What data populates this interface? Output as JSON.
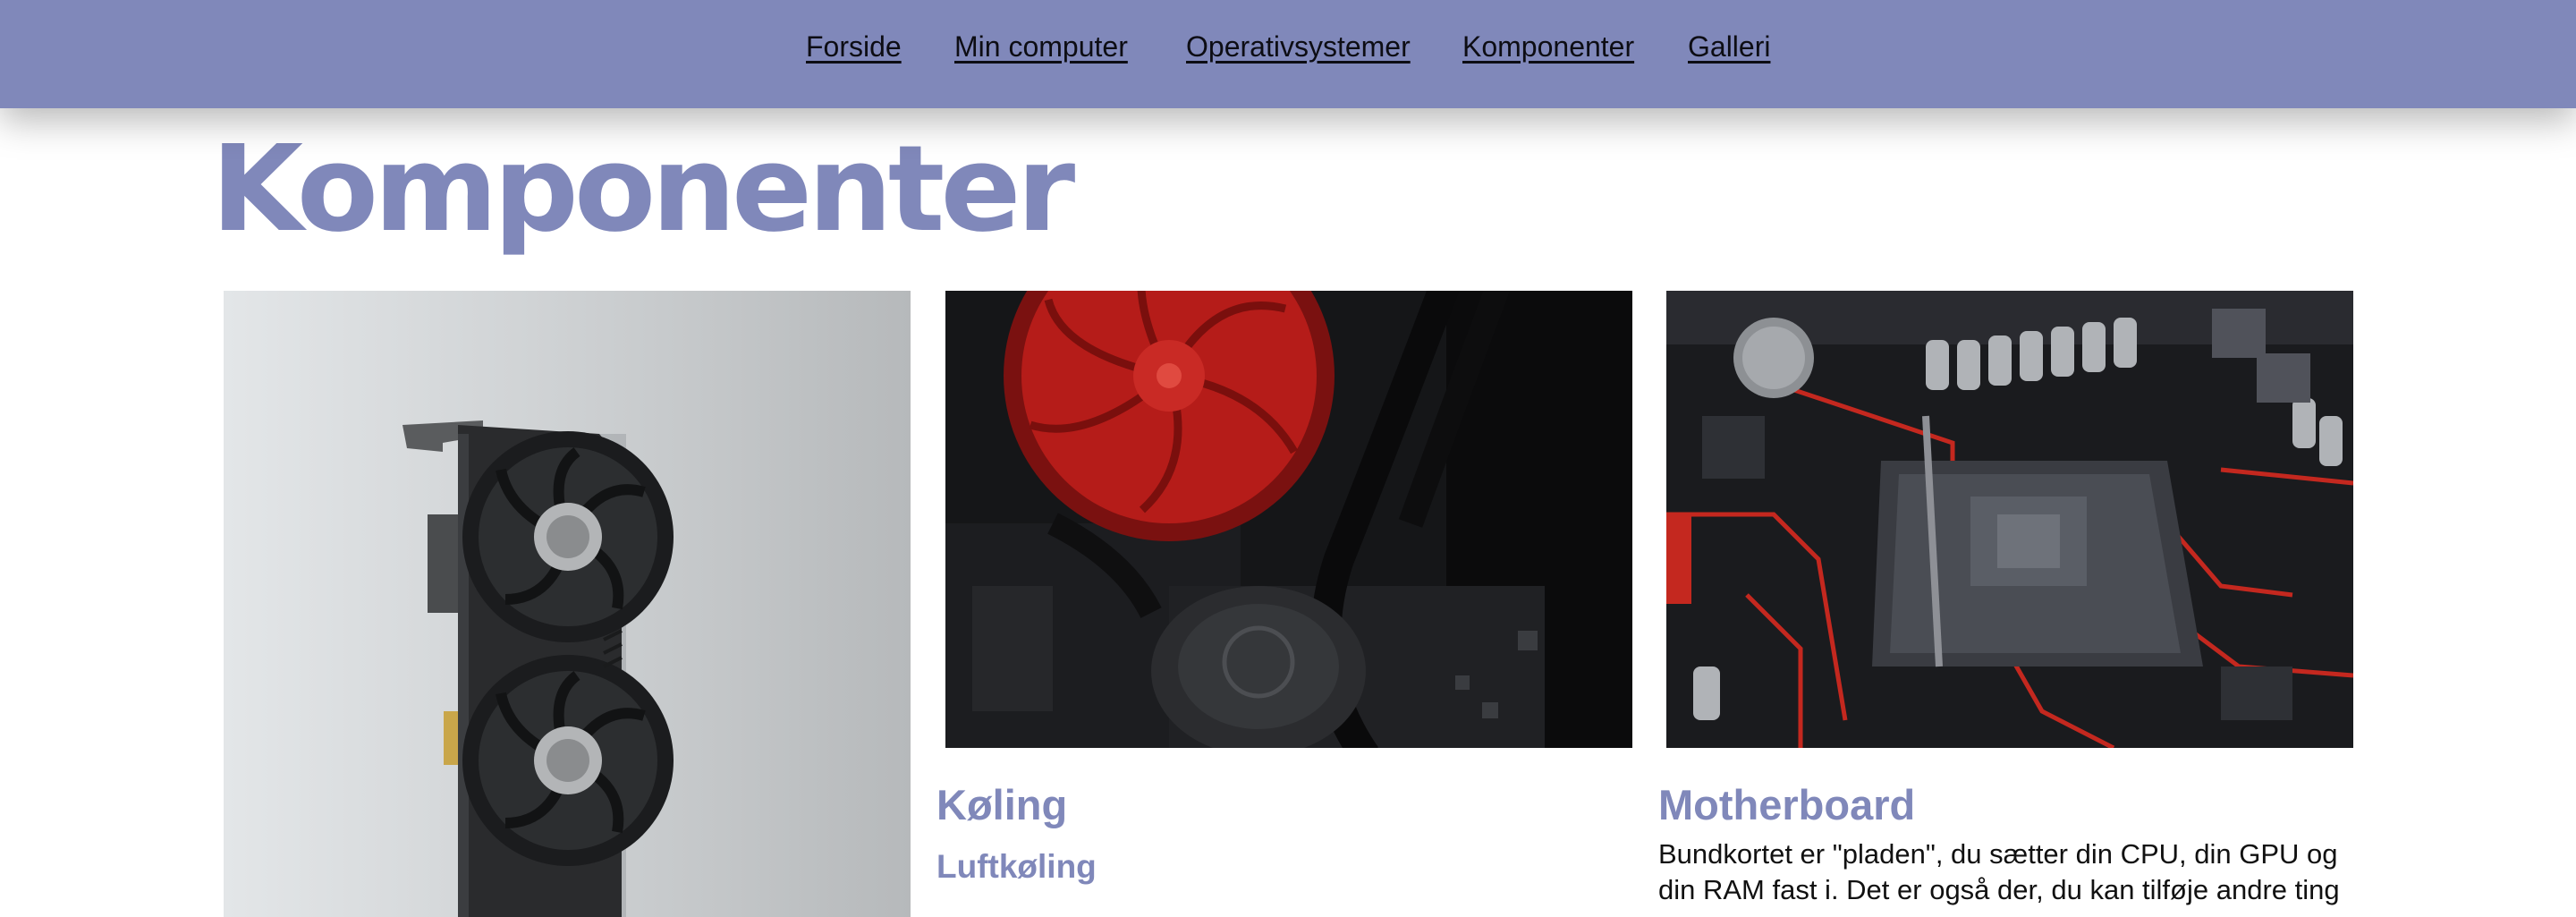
{
  "nav": {
    "items": [
      "Forside",
      "Min computer",
      "Operativsystemer",
      "Komponenter",
      "Galleri"
    ]
  },
  "page": {
    "title": "Komponenter"
  },
  "cards": [
    {
      "image_subject": "graphics card",
      "title": ""
    },
    {
      "image_subject": "red cpu fan and water cooling",
      "title": "Køling",
      "subtitle": "Luftkøling"
    },
    {
      "image_subject": "motherboard cpu socket",
      "title": "Motherboard",
      "text": "Bundkortet er \"pladen\", du sætter din CPU, din GPU og din RAM fast i. Det er også der, du kan tilføje andre ting"
    }
  ],
  "colors": {
    "nav_bg": "#8088ba",
    "accent": "#8088ba",
    "text": "#111111",
    "background": "#ffffff"
  }
}
